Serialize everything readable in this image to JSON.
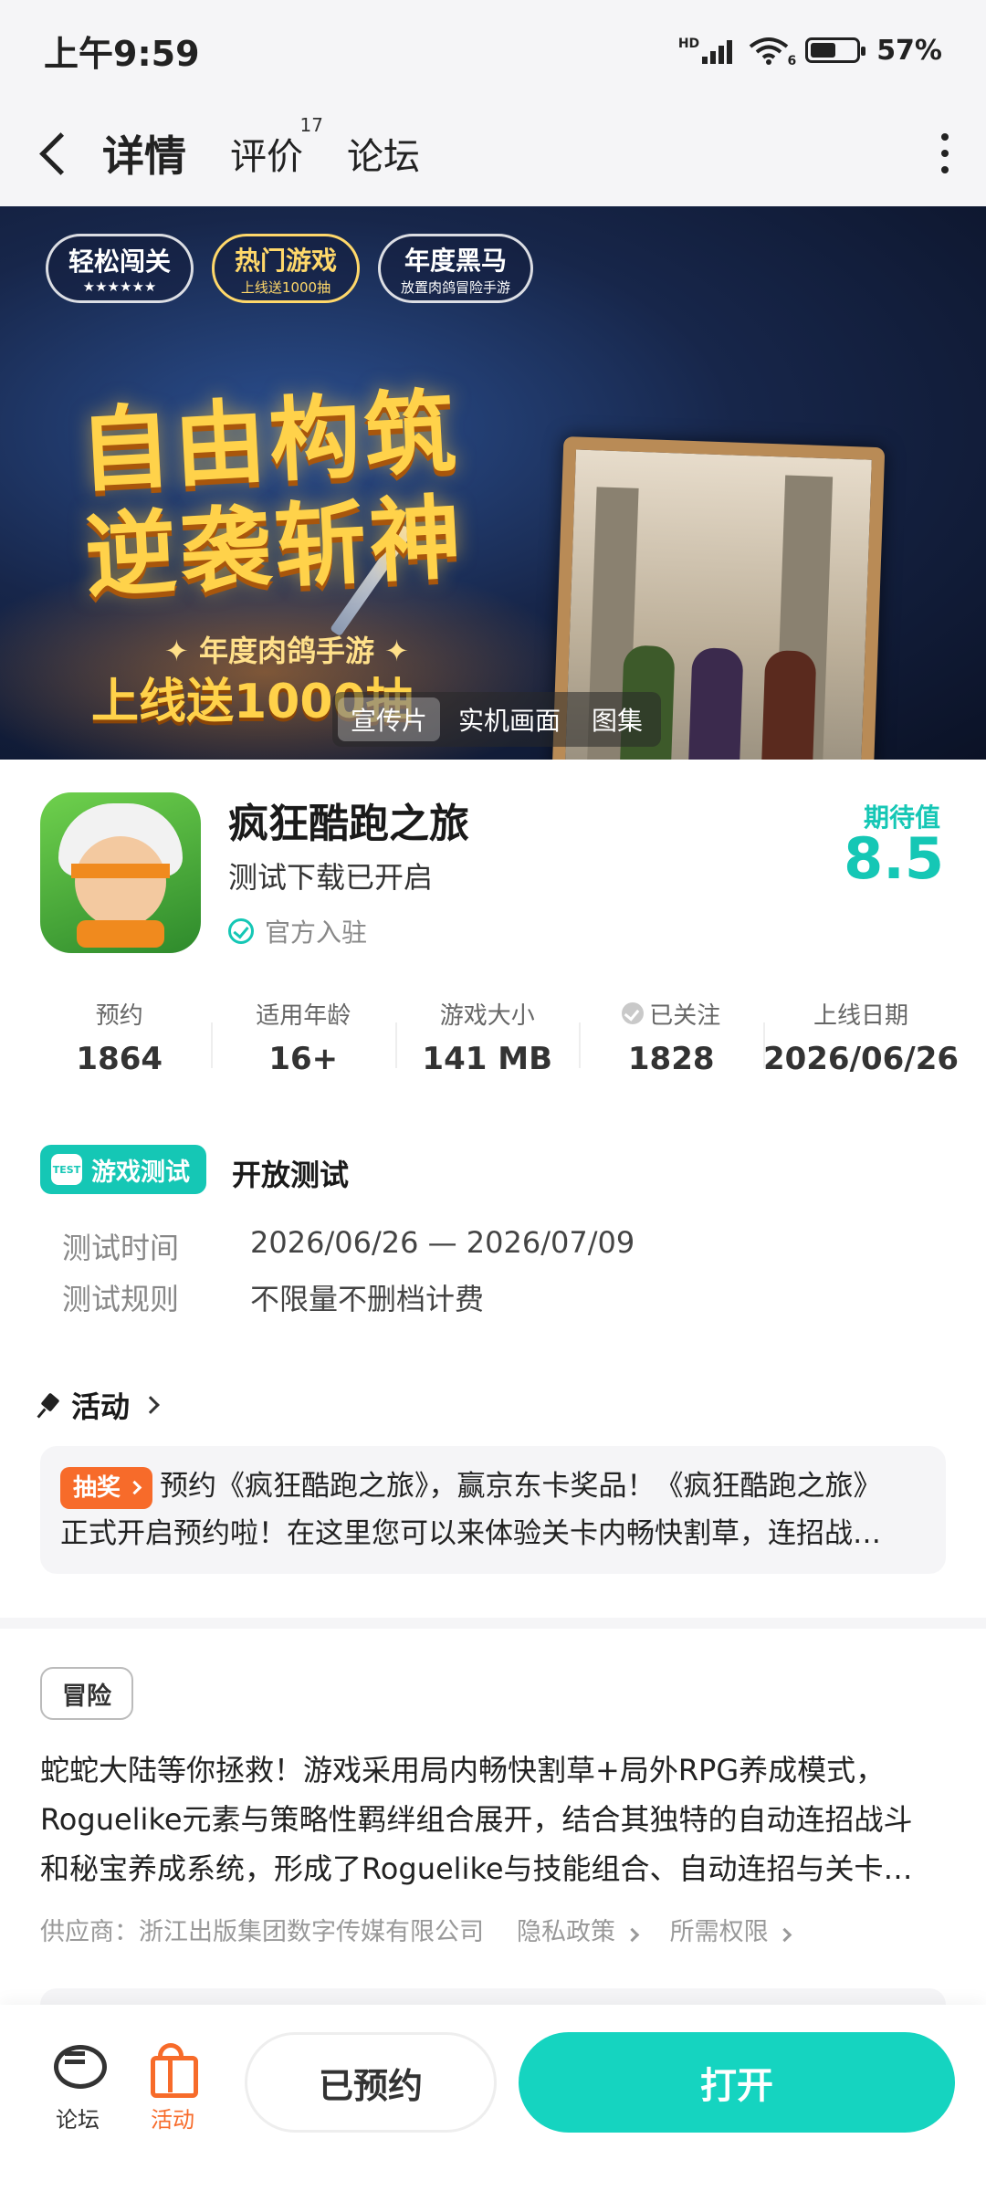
{
  "status_bar": {
    "time": "上午9:59",
    "network": "HD",
    "wifi": "6",
    "battery": "57%",
    "battery_level": 0.57
  },
  "nav": {
    "tabs": [
      {
        "label": "详情",
        "active": true
      },
      {
        "label": "评价",
        "badge": "17"
      },
      {
        "label": "论坛"
      }
    ]
  },
  "banner": {
    "badges": [
      {
        "main": "轻松闯关",
        "sub": "★★★★★★"
      },
      {
        "main": "热门游戏",
        "sub": "上线送1000抽"
      },
      {
        "main": "年度黑马",
        "sub": "放置肉鸽冒险手游"
      }
    ],
    "title_line1": "自由构筑",
    "title_line2": "逆袭斩神",
    "subtitle": "✦ 年度肉鸽手游 ✦",
    "bottom_text": "上线送1000抽",
    "media_tabs": [
      "宣传片",
      "实机画面",
      "图集"
    ]
  },
  "app": {
    "name": "疯狂酷跑之旅",
    "status": "测试下载已开启",
    "official": "官方入驻",
    "expect_label": "期待值",
    "expect_score": "8.5"
  },
  "stats": [
    {
      "label": "预约",
      "value": "1864"
    },
    {
      "label": "适用年龄",
      "value": "16+"
    },
    {
      "label": "游戏大小",
      "value": "141 MB"
    },
    {
      "label": "已关注",
      "value": "1828",
      "icon": "heart-icon"
    },
    {
      "label": "上线日期",
      "value": "2026/06/26"
    }
  ],
  "test": {
    "tag_icon": "TEST",
    "tag": "游戏测试",
    "title": "开放测试",
    "rows": [
      {
        "key": "测试时间",
        "value": "2026/06/26 — 2026/07/09"
      },
      {
        "key": "测试规则",
        "value": "不限量不删档计费"
      }
    ]
  },
  "activity": {
    "heading": "活动",
    "tag": "抽奖",
    "line1": "预约《疯狂酷跑之旅》，赢京东卡奖品！《疯狂酷跑之旅》",
    "line2": "正式开启预约啦！在这里您可以来体验关卡内畅快割草，连招战…"
  },
  "description": {
    "genre": "冒险",
    "lines": [
      "蛇蛇大陆等你拯救！游戏采用局内畅快割草+局外RPG养成模式，",
      "Roguelike元素与策略性羁绊组合展开，结合其独特的自动连招战斗",
      "和秘宝养成系统，形成了Roguelike与技能组合、自动连招与关卡…"
    ],
    "supplier": "供应商：浙江出版集团数字传媒有限公司",
    "privacy": "隐私政策",
    "permissions": "所需权限"
  },
  "bottom_bar": {
    "forum": "论坛",
    "activity": "活动",
    "reserved": "已预约",
    "open": "打开"
  },
  "colors": {
    "accent": "#15c7b5",
    "open_button": "#15d4c0",
    "lottery": "#f76b2a"
  }
}
